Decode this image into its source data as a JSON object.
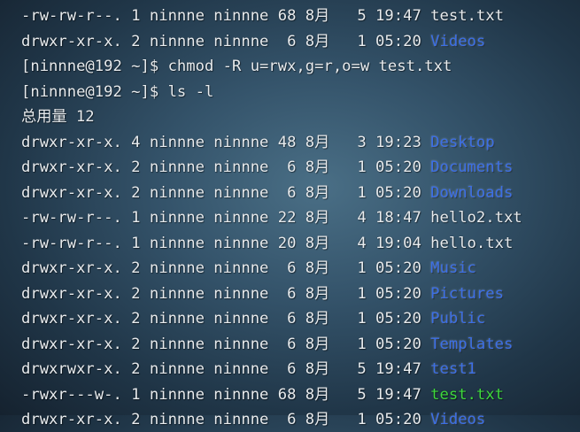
{
  "terminal": {
    "lines": [
      {
        "text": "-rw-rw-r--. 1 ninnne ninnne 68 8月   5 19:47 ",
        "name": "test.txt",
        "kind": "file"
      },
      {
        "text": "drwxr-xr-x. 2 ninnne ninnne  6 8月   1 05:20 ",
        "name": "Videos",
        "kind": "dir"
      },
      {
        "text": "[ninnne@192 ~]$ chmod -R u=rwx,g=r,o=w test.txt",
        "name": "",
        "kind": "prompt"
      },
      {
        "text": "[ninnne@192 ~]$ ls -l",
        "name": "",
        "kind": "prompt"
      },
      {
        "text": "总用量 12",
        "name": "",
        "kind": "plain"
      },
      {
        "text": "drwxr-xr-x. 4 ninnne ninnne 48 8月   3 19:23 ",
        "name": "Desktop",
        "kind": "dir"
      },
      {
        "text": "drwxr-xr-x. 2 ninnne ninnne  6 8月   1 05:20 ",
        "name": "Documents",
        "kind": "dir"
      },
      {
        "text": "drwxr-xr-x. 2 ninnne ninnne  6 8月   1 05:20 ",
        "name": "Downloads",
        "kind": "dir"
      },
      {
        "text": "-rw-rw-r--. 1 ninnne ninnne 22 8月   4 18:47 ",
        "name": "hello2.txt",
        "kind": "file"
      },
      {
        "text": "-rw-rw-r--. 1 ninnne ninnne 20 8月   4 19:04 ",
        "name": "hello.txt",
        "kind": "file"
      },
      {
        "text": "drwxr-xr-x. 2 ninnne ninnne  6 8月   1 05:20 ",
        "name": "Music",
        "kind": "dir"
      },
      {
        "text": "drwxr-xr-x. 2 ninnne ninnne  6 8月   1 05:20 ",
        "name": "Pictures",
        "kind": "dir"
      },
      {
        "text": "drwxr-xr-x. 2 ninnne ninnne  6 8月   1 05:20 ",
        "name": "Public",
        "kind": "dir"
      },
      {
        "text": "drwxr-xr-x. 2 ninnne ninnne  6 8月   1 05:20 ",
        "name": "Templates",
        "kind": "dir"
      },
      {
        "text": "drwxrwxr-x. 2 ninnne ninnne  6 8月   5 19:47 ",
        "name": "test1",
        "kind": "dir"
      },
      {
        "text": "-rwxr---w-. 1 ninnne ninnne 68 8月   5 19:47 ",
        "name": "test.txt",
        "kind": "exec"
      },
      {
        "text": "drwxr-xr-x. 2 ninnne ninnne  6 8月   1 05:20 ",
        "name": "Videos",
        "kind": "dir"
      }
    ]
  },
  "colors": {
    "directory": "#3b6fe6",
    "executable": "#3fd93f",
    "text": "#e8ecef"
  }
}
